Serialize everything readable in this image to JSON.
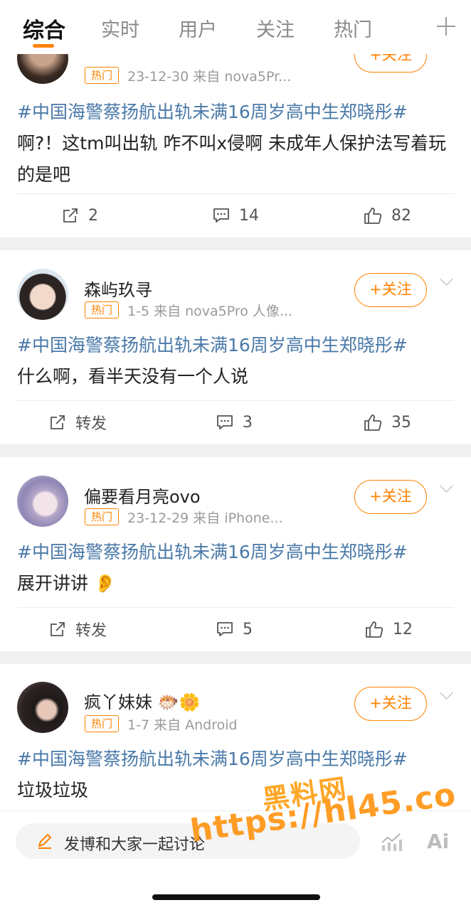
{
  "tabs": [
    {
      "label": "综合",
      "active": true
    },
    {
      "label": "实时",
      "active": false
    },
    {
      "label": "用户",
      "active": false
    },
    {
      "label": "关注",
      "active": false
    },
    {
      "label": "热门",
      "active": false
    }
  ],
  "accent_color": "#ff8200",
  "hashtag_color": "#4a79a8",
  "posts": [
    {
      "username": "",
      "badge": "热门",
      "meta": "23-12-30 来自 nova5Pr...",
      "follow_label": "+关注",
      "hashtag": "#中国海警蔡扬航出轨未满16周岁高中生郑晓彤#",
      "text": "啊?！这tm叫出轨 咋不叫x侵啊 未成年人保护法写着玩的是吧",
      "repost": "2",
      "comments": "14",
      "likes": "82"
    },
    {
      "username": "森屿玖寻",
      "badge": "热门",
      "meta": "1-5 来自 nova5Pro 人像...",
      "follow_label": "+关注",
      "hashtag": "#中国海警蔡扬航出轨未满16周岁高中生郑晓彤#",
      "text": "什么啊，看半天没有一个人说",
      "repost": "转发",
      "comments": "3",
      "likes": "35"
    },
    {
      "username": "偏要看月亮ovo",
      "badge": "热门",
      "meta": "23-12-29 来自 iPhone...",
      "follow_label": "+关注",
      "hashtag": "#中国海警蔡扬航出轨未满16周岁高中生郑晓彤#",
      "text": "展开讲讲 👂",
      "repost": "转发",
      "comments": "5",
      "likes": "12"
    },
    {
      "username": "疯丫妹妹 🐡🌼",
      "badge": "热门",
      "meta": "1-7 来自 Android",
      "follow_label": "+关注",
      "hashtag": "#中国海警蔡扬航出轨未满16周岁高中生郑晓彤#",
      "text": "垃圾垃圾"
    }
  ],
  "bottom": {
    "compose_placeholder": "发博和大家一起讨论",
    "ai_label": "Ai"
  },
  "watermark": {
    "line1": "黑料网",
    "line2": "https://hl45.co"
  }
}
